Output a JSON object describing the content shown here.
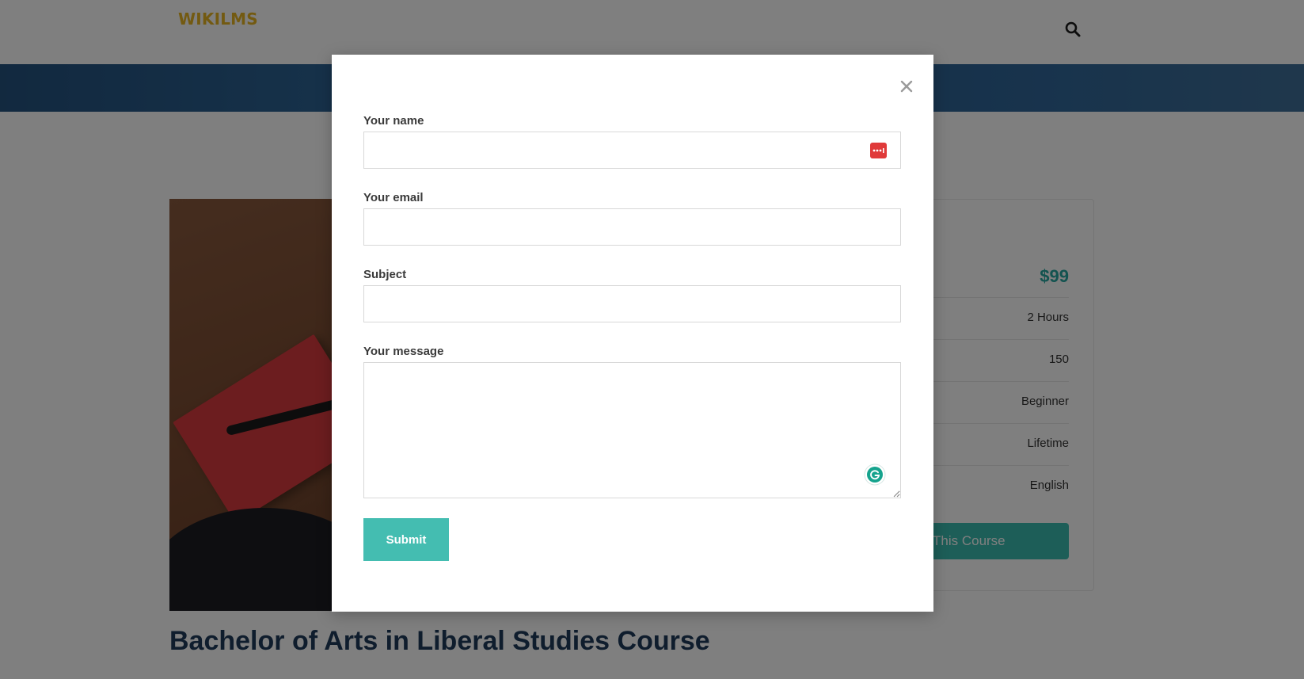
{
  "header": {
    "logo_text": "WIKILMS",
    "search_icon": "search-icon"
  },
  "course": {
    "title": "Bachelor of Arts in Liberal Studies Course"
  },
  "sidebar": {
    "heading_tail": ":",
    "price": "$99",
    "rows": [
      {
        "label": "",
        "value": "2 Hours"
      },
      {
        "label": "",
        "value": "150"
      },
      {
        "label": "",
        "value": "Beginner"
      },
      {
        "label": ":",
        "value": "Lifetime"
      },
      {
        "label": "",
        "value": "English"
      }
    ],
    "enroll_label": "This Course"
  },
  "modal": {
    "close_icon": "close-icon",
    "fields": {
      "name": {
        "label": "Your name",
        "value": ""
      },
      "email": {
        "label": "Your email",
        "value": ""
      },
      "subject": {
        "label": "Subject",
        "value": ""
      },
      "message": {
        "label": "Your message",
        "value": ""
      }
    },
    "submit_label": "Submit"
  },
  "colors": {
    "accent": "#44bdb1",
    "logo": "#e6b422",
    "price": "#27a6a0",
    "banner": "#2a5e8e",
    "title": "#1f3a5a"
  }
}
